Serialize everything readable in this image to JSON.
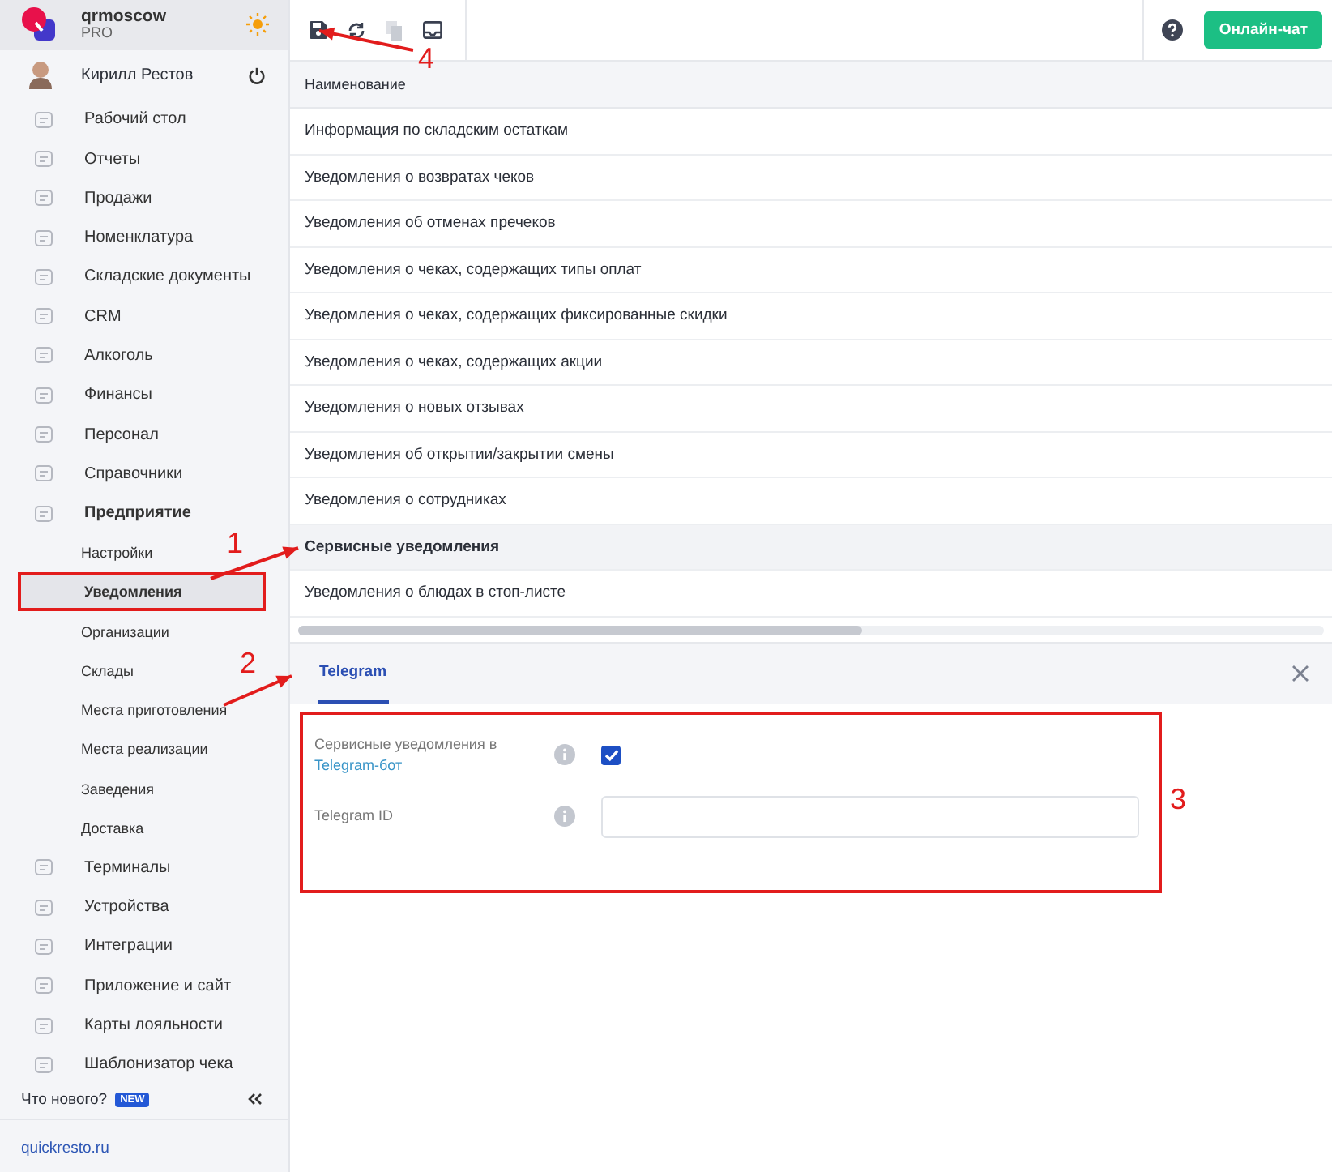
{
  "brand": {
    "name": "qrmoscow",
    "plan": "PRO"
  },
  "user": {
    "name": "Кирилл Рестов"
  },
  "sidebar": {
    "items": [
      {
        "label": "Рабочий стол",
        "kind": "section",
        "expanded": false
      },
      {
        "label": "Отчеты",
        "kind": "section",
        "expanded": false
      },
      {
        "label": "Продажи",
        "kind": "section",
        "expanded": false
      },
      {
        "label": "Номенклатура",
        "kind": "section",
        "expanded": false
      },
      {
        "label": "Складские документы",
        "kind": "section",
        "expanded": false
      },
      {
        "label": "CRM",
        "kind": "section",
        "expanded": false
      },
      {
        "label": "Алкоголь",
        "kind": "section",
        "expanded": false
      },
      {
        "label": "Финансы",
        "kind": "section",
        "expanded": false
      },
      {
        "label": "Персонал",
        "kind": "section",
        "expanded": false
      },
      {
        "label": "Справочники",
        "kind": "section",
        "expanded": false
      },
      {
        "label": "Предприятие",
        "kind": "section",
        "expanded": true
      },
      {
        "label": "Настройки",
        "kind": "sub",
        "selected": false
      },
      {
        "label": "Уведомления",
        "kind": "sub",
        "selected": true
      },
      {
        "label": "Организации",
        "kind": "sub",
        "selected": false
      },
      {
        "label": "Склады",
        "kind": "sub",
        "selected": false
      },
      {
        "label": "Места приготовления",
        "kind": "sub",
        "selected": false
      },
      {
        "label": "Места реализации",
        "kind": "sub",
        "selected": false
      },
      {
        "label": "Заведения",
        "kind": "sub",
        "selected": false
      },
      {
        "label": "Доставка",
        "kind": "sub",
        "selected": false
      },
      {
        "label": "Терминалы",
        "kind": "section",
        "expanded": false
      },
      {
        "label": "Устройства",
        "kind": "section",
        "expanded": false
      },
      {
        "label": "Интеграции",
        "kind": "section",
        "expanded": false
      },
      {
        "label": "Приложение и сайт",
        "kind": "section",
        "expanded": false
      },
      {
        "label": "Карты лояльности",
        "kind": "section",
        "expanded": false
      },
      {
        "label": "Шаблонизатор чека",
        "kind": "section",
        "expanded": false
      }
    ],
    "whats_new": "Что нового?",
    "new_badge": "NEW",
    "site_link": "quickresto.ru"
  },
  "toolbar": {
    "buttons": [
      {
        "disabled": false
      },
      {
        "disabled": false
      },
      {
        "disabled": true
      },
      {
        "disabled": false
      }
    ],
    "chat_button": "Онлайн-чат"
  },
  "table": {
    "columns": [
      "Наименование"
    ],
    "rows": [
      {
        "name": "Информация по складским остаткам",
        "selected": false
      },
      {
        "name": "Уведомления о возвратах чеков",
        "selected": false
      },
      {
        "name": "Уведомления об отменах пречеков",
        "selected": false
      },
      {
        "name": "Уведомления о чеках, содержащих типы оплат",
        "selected": false
      },
      {
        "name": "Уведомления о чеках, содержащих фиксированные скидки",
        "selected": false
      },
      {
        "name": "Уведомления о чеках, содержащих акции",
        "selected": false
      },
      {
        "name": "Уведомления о новых отзывах",
        "selected": false
      },
      {
        "name": "Уведомления об открытии/закрытии смены",
        "selected": false
      },
      {
        "name": "Уведомления о сотрудниках",
        "selected": false
      },
      {
        "name": "Сервисные уведомления",
        "selected": true
      },
      {
        "name": "Уведомления о блюдах в стоп-листе",
        "selected": false
      }
    ]
  },
  "detail": {
    "tabs": [
      {
        "label": "Telegram",
        "selected": true
      }
    ],
    "fields": [
      {
        "kind": "checkbox",
        "label": "Сервисные уведомления в",
        "link": "Telegram-бот",
        "checked": true
      },
      {
        "kind": "text",
        "label": "Telegram ID"
      }
    ]
  },
  "annotations": [
    {
      "label": "1"
    },
    {
      "label": "2"
    },
    {
      "label": "3"
    },
    {
      "label": "4"
    }
  ]
}
